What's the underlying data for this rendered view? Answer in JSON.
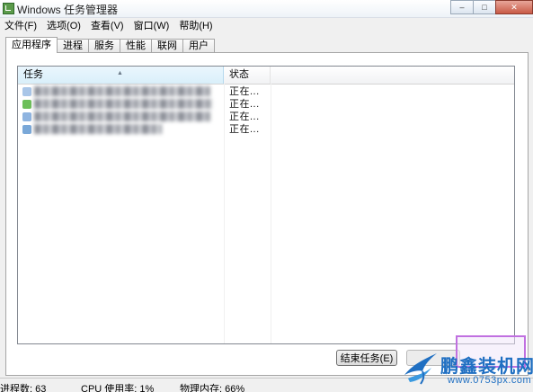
{
  "window": {
    "title": "Windows 任务管理器",
    "controls": [
      "–",
      "□",
      "✕"
    ]
  },
  "menu": [
    "文件(F)",
    "选项(O)",
    "查看(V)",
    "窗口(W)",
    "帮助(H)"
  ],
  "tabs": [
    {
      "label": "应用程序",
      "active": true
    },
    {
      "label": "进程",
      "active": false
    },
    {
      "label": "服务",
      "active": false
    },
    {
      "label": "性能",
      "active": false
    },
    {
      "label": "联网",
      "active": false
    },
    {
      "label": "用户",
      "active": false
    }
  ],
  "list": {
    "columns": {
      "task": "任务",
      "status": "状态"
    },
    "sort_indicator": "▲",
    "rows": [
      {
        "status": "正在...",
        "icon_color": "#a9c6e8"
      },
      {
        "status": "正在...",
        "icon_color": "#6dbf5a"
      },
      {
        "status": "正在...",
        "icon_color": "#8fb4e0"
      },
      {
        "status": "正在...",
        "icon_color": "#7aa8d8"
      }
    ]
  },
  "buttons": {
    "end_task": "结束任务(E)"
  },
  "statusbar": {
    "processes": "进程数: 63",
    "cpu": "CPU 使用率: 1%",
    "memory": "物理内存: 66%"
  },
  "watermark": {
    "title": "鹏鑫装机网",
    "url": "www.0753px.com"
  },
  "colors": {
    "selected_header": "#d9effa",
    "highlight_box": "#c070e0",
    "watermark_blue": "#1f6fc2"
  }
}
